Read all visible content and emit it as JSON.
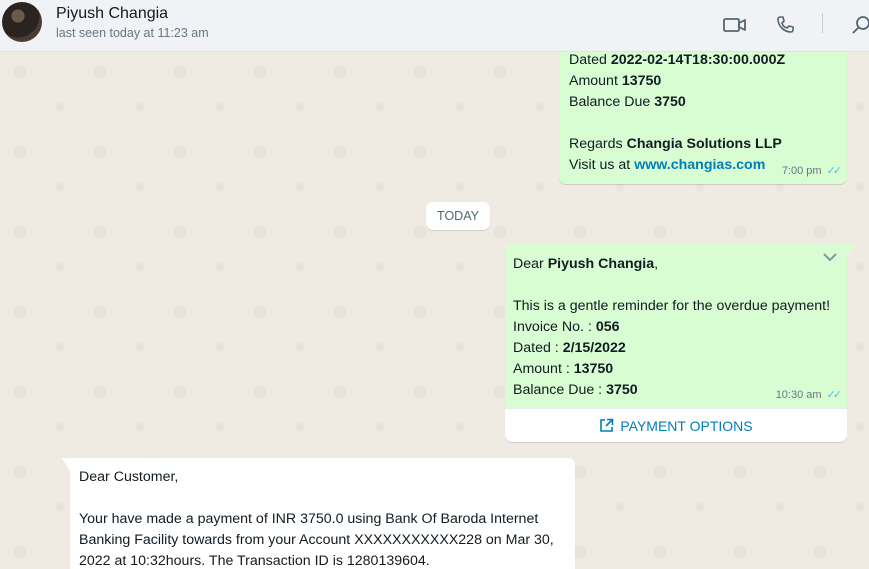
{
  "header": {
    "contact_name": "Piyush Changia",
    "status": "last seen today at 11:23 am",
    "icons": [
      "video-call-icon",
      "voice-call-icon",
      "search-icon"
    ]
  },
  "msg1": {
    "dated_label": "Dated ",
    "dated_value": "2022-02-14T18:30:00.000Z",
    "amount_label": "Amount ",
    "amount_value": "13750",
    "balance_label": "Balance Due ",
    "balance_value": "3750",
    "regards_label": "Regards ",
    "regards_value": "Changia Solutions LLP",
    "visit_label": "Visit us at ",
    "visit_link": "www.changias.com",
    "time": "7:00 pm"
  },
  "date_divider": "TODAY",
  "msg2": {
    "greeting_prefix": "Dear ",
    "greeting_name": "Piyush Changia",
    "greeting_suffix": ",",
    "reminder": "This is a gentle reminder for the overdue payment!",
    "invoice_label": "Invoice No. : ",
    "invoice_value": "056",
    "dated_label": "Dated : ",
    "dated_value": "2/15/2022",
    "amount_label": "Amount : ",
    "amount_value": "13750",
    "balance_label": "Balance Due : ",
    "balance_value": "3750",
    "time": "10:30 am",
    "button_label": "PAYMENT OPTIONS"
  },
  "msg3": {
    "greeting": "Dear Customer,",
    "line1": "Your have made a payment of INR 3750.0 using Bank Of Baroda Internet",
    "line2": "Banking Facility towards from your Account XXXXXXXXXXX228 on Mar 30,",
    "line3": "2022 at 10:32hours. The Transaction ID is 1280139604."
  },
  "colors": {
    "outgoing_bubble": "#d9fdd3",
    "incoming_bubble": "#ffffff",
    "link": "#027eb5",
    "read_ticks": "#53bdeb"
  }
}
